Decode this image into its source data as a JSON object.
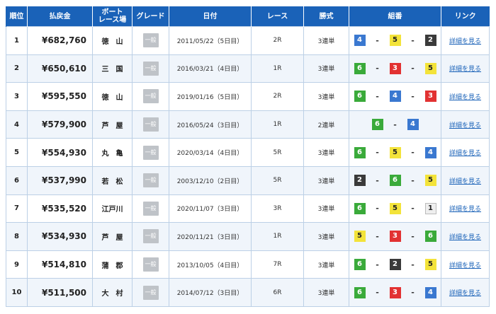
{
  "headers": {
    "rank": "順位",
    "payout": "払戻金",
    "stadium_line1": "ボート",
    "stadium_line2": "レース場",
    "grade": "グレード",
    "date": "日付",
    "race": "レース",
    "bet_type": "勝式",
    "combination": "組番",
    "link": "リンク"
  },
  "rows": [
    {
      "rank": "1",
      "payout": "¥682,760",
      "stadium": "徳　山",
      "grade": "一般",
      "date": "2011/05/22（5日目）",
      "race": "2R",
      "bet_type": "3連単",
      "combo": [
        4,
        5,
        2
      ],
      "link": "詳細を見る"
    },
    {
      "rank": "2",
      "payout": "¥650,610",
      "stadium": "三　国",
      "grade": "一般",
      "date": "2016/03/21（4日目）",
      "race": "1R",
      "bet_type": "3連単",
      "combo": [
        6,
        3,
        5
      ],
      "link": "詳細を見る"
    },
    {
      "rank": "3",
      "payout": "¥595,550",
      "stadium": "徳　山",
      "grade": "一般",
      "date": "2019/01/16（5日目）",
      "race": "2R",
      "bet_type": "3連単",
      "combo": [
        6,
        4,
        3
      ],
      "link": "詳細を見る"
    },
    {
      "rank": "4",
      "payout": "¥579,900",
      "stadium": "芦　屋",
      "grade": "一般",
      "date": "2016/05/24（3日目）",
      "race": "1R",
      "bet_type": "2連単",
      "combo": [
        6,
        4
      ],
      "link": "詳細を見る"
    },
    {
      "rank": "5",
      "payout": "¥554,930",
      "stadium": "丸　亀",
      "grade": "一般",
      "date": "2020/03/14（4日目）",
      "race": "5R",
      "bet_type": "3連単",
      "combo": [
        6,
        5,
        4
      ],
      "link": "詳細を見る"
    },
    {
      "rank": "6",
      "payout": "¥537,990",
      "stadium": "若　松",
      "grade": "一般",
      "date": "2003/12/10（2日目）",
      "race": "5R",
      "bet_type": "3連単",
      "combo": [
        2,
        6,
        5
      ],
      "link": "詳細を見る"
    },
    {
      "rank": "7",
      "payout": "¥535,520",
      "stadium": "江戸川",
      "grade": "一般",
      "date": "2020/11/07（3日目）",
      "race": "3R",
      "bet_type": "3連単",
      "combo": [
        6,
        5,
        1
      ],
      "link": "詳細を見る"
    },
    {
      "rank": "8",
      "payout": "¥534,930",
      "stadium": "芦　屋",
      "grade": "一般",
      "date": "2020/11/21（3日目）",
      "race": "1R",
      "bet_type": "3連単",
      "combo": [
        5,
        3,
        6
      ],
      "link": "詳細を見る"
    },
    {
      "rank": "9",
      "payout": "¥514,810",
      "stadium": "蒲　郡",
      "grade": "一般",
      "date": "2013/10/05（4日目）",
      "race": "7R",
      "bet_type": "3連単",
      "combo": [
        6,
        2,
        5
      ],
      "link": "詳細を見る"
    },
    {
      "rank": "10",
      "payout": "¥511,500",
      "stadium": "大　村",
      "grade": "一般",
      "date": "2014/07/12（3日目）",
      "race": "6R",
      "bet_type": "3連単",
      "combo": [
        6,
        3,
        4
      ],
      "link": "詳細を見る"
    }
  ],
  "boat_colors": {
    "1": "#eeeeee",
    "2": "#3a3a3a",
    "3": "#e23232",
    "4": "#3a78d0",
    "5": "#f3e33a",
    "6": "#3aaa3a"
  },
  "header_color": "#1a62b8"
}
